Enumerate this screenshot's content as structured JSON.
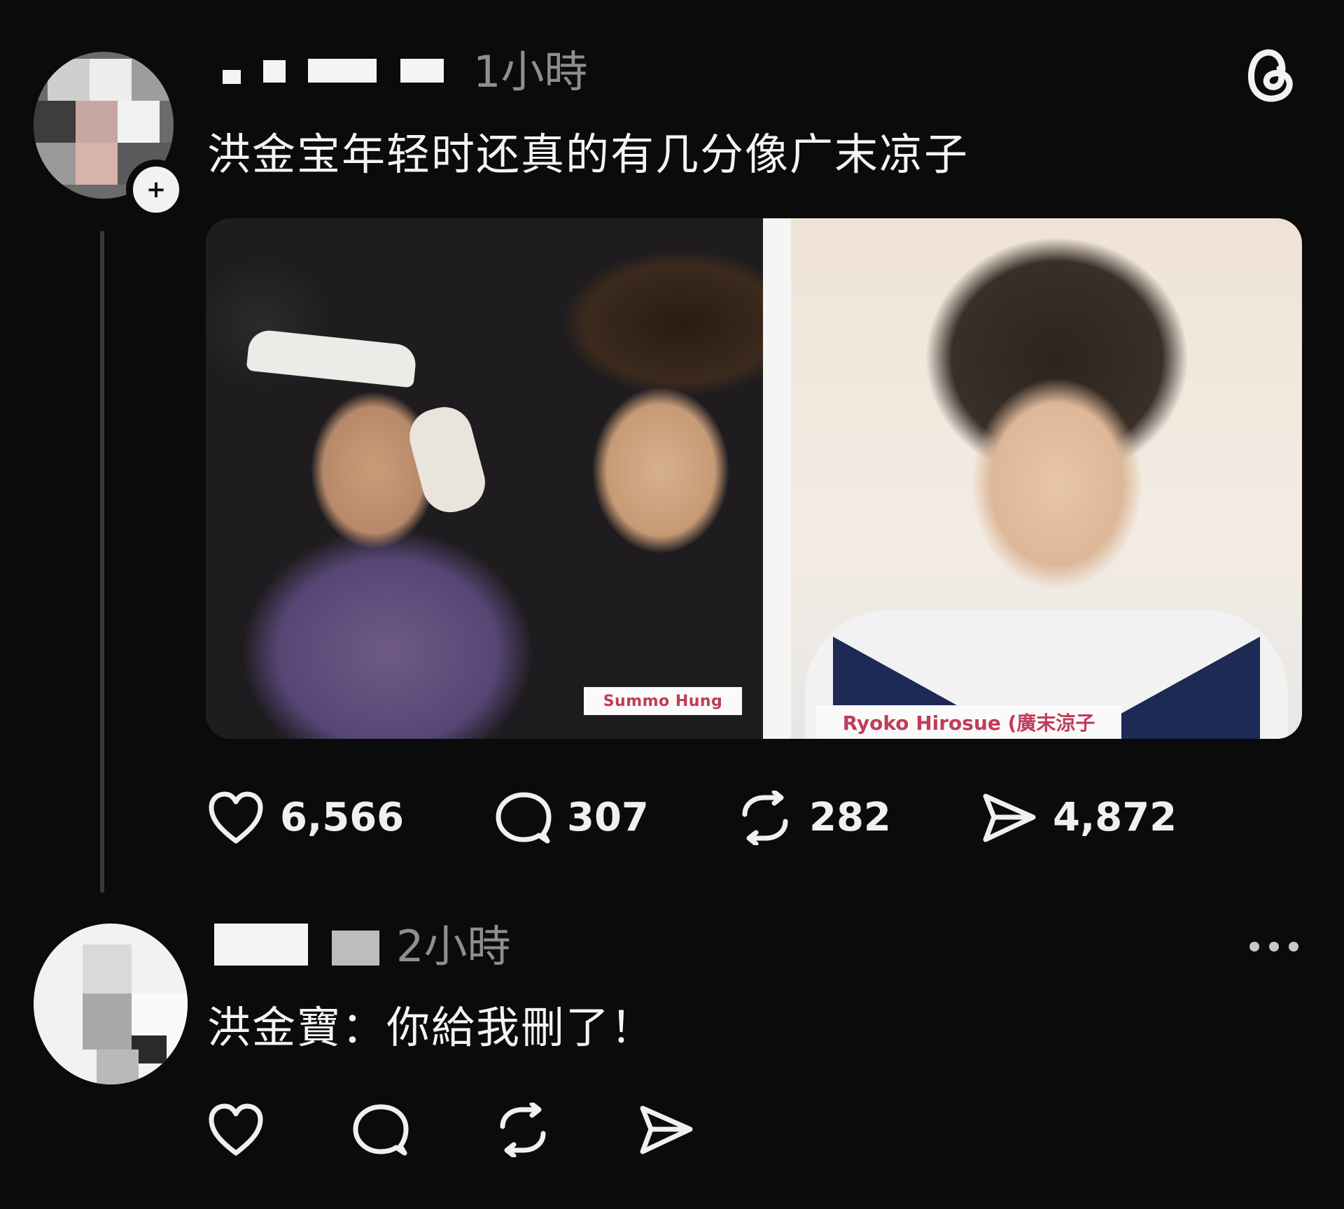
{
  "post": {
    "time": "1小時",
    "text": "洪金宝年轻时还真的有几分像广末凉子",
    "image": {
      "left_caption": "Summo Hung",
      "right_caption": "Ryoko Hirosue (廣末涼子"
    },
    "actions": {
      "likes": "6,566",
      "comments": "307",
      "reposts": "282",
      "shares": "4,872"
    }
  },
  "reply": {
    "time": "2小時",
    "text": "洪金寶：你給我刪了！"
  },
  "icons": {
    "app_logo": "threads-logo-icon",
    "like": "heart-icon",
    "comment": "comment-bubble-icon",
    "repost": "repost-icon",
    "share": "send-icon",
    "more": "more-horizontal-icon",
    "follow": "plus-icon"
  }
}
